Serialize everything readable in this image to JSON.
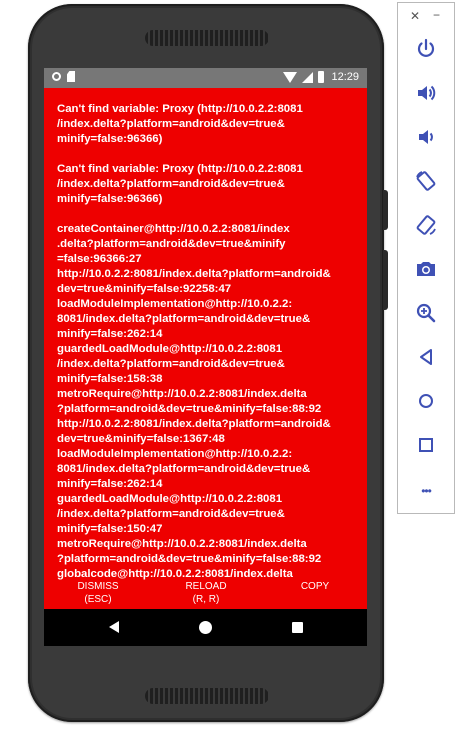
{
  "status_bar": {
    "time": "12:29",
    "icons": [
      "circle-notification-icon",
      "sd-card-icon",
      "wifi-icon",
      "signal-icon",
      "battery-icon"
    ]
  },
  "error": {
    "message_1": "Can't find variable: Proxy (http://10.0.2.2:8081\n/index.delta?platform=android&dev=true&\nminify=false:96366)",
    "message_2": "Can't find variable: Proxy (http://10.0.2.2:8081\n/index.delta?platform=android&dev=true&\nminify=false:96366)",
    "stack_trace": "createContainer@http://10.0.2.2:8081/index\n.delta?platform=android&dev=true&minify\n=false:96366:27\nhttp://10.0.2.2:8081/index.delta?platform=android&\ndev=true&minify=false:92258:47\nloadModuleImplementation@http://10.0.2.2:\n8081/index.delta?platform=android&dev=true&\nminify=false:262:14\nguardedLoadModule@http://10.0.2.2:8081\n/index.delta?platform=android&dev=true&\nminify=false:158:38\nmetroRequire@http://10.0.2.2:8081/index.delta\n?platform=android&dev=true&minify=false:88:92\nhttp://10.0.2.2:8081/index.delta?platform=android&\ndev=true&minify=false:1367:48\nloadModuleImplementation@http://10.0.2.2:\n8081/index.delta?platform=android&dev=true&\nminify=false:262:14\nguardedLoadModule@http://10.0.2.2:8081\n/index.delta?platform=android&dev=true&\nminify=false:150:47\nmetroRequire@http://10.0.2.2:8081/index.delta\n?platform=android&dev=true&minify=false:88:92\nglobalcode@http://10.0.2.2:8081/index.delta"
  },
  "actions": {
    "dismiss_label": "DISMISS",
    "dismiss_sub": "(ESC)",
    "reload_label": "RELOAD",
    "reload_sub": "(R, R)",
    "copy_label": "COPY"
  },
  "nav_bar": {
    "icons": [
      "back-icon",
      "home-icon",
      "recents-icon"
    ]
  },
  "emulator_panel": {
    "close_glyph": "✕",
    "minimize_glyph": "−",
    "more_glyph": "•••",
    "buttons": [
      "power-icon",
      "volume-up-icon",
      "volume-down-icon",
      "rotate-left-icon",
      "rotate-right-icon",
      "camera-icon",
      "zoom-icon",
      "back-icon",
      "home-icon",
      "overview-icon",
      "more-icon"
    ]
  },
  "colors": {
    "error_background": "#ee0000",
    "status_bar": "#777777",
    "nav_bar": "#000000",
    "emulator_icon": "#3f51b5"
  }
}
